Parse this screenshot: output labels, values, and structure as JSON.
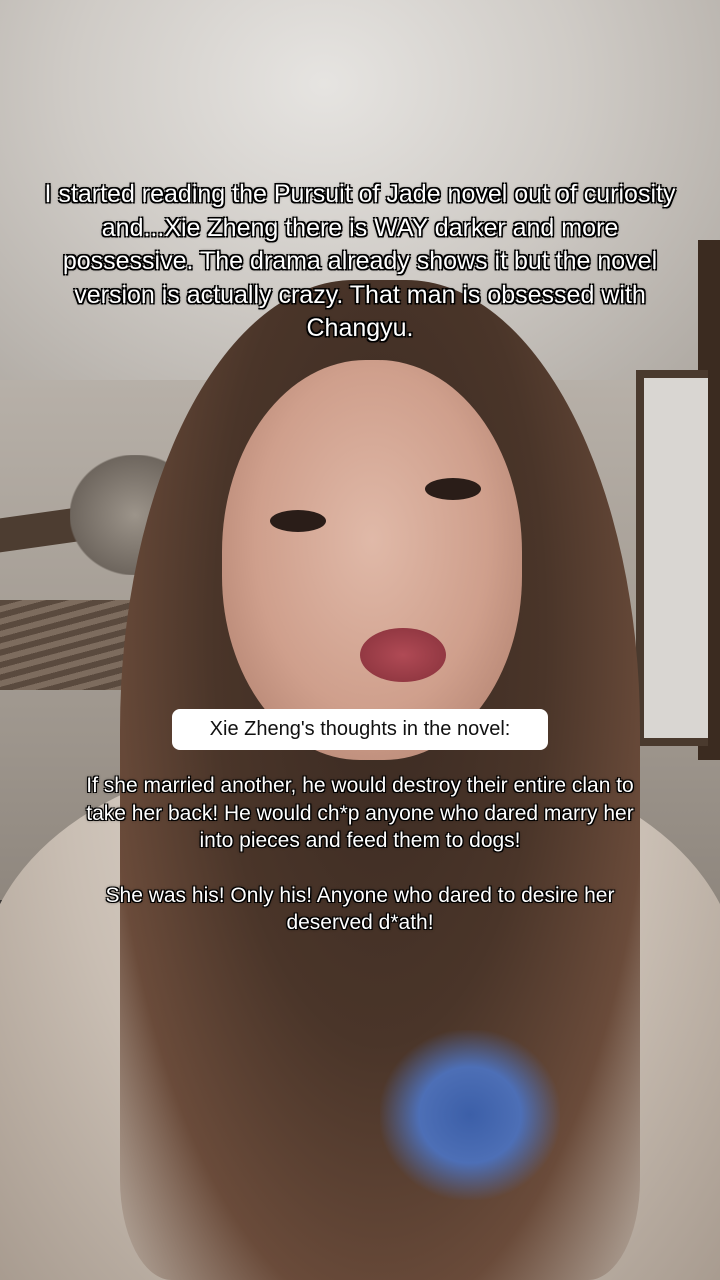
{
  "overlay": {
    "caption": "I started reading the Pursuit of Jade novel out of curiosity and...Xie Zheng there is WAY darker and more possessive. The drama already shows it but the novel version is actually crazy. That man is obsessed with Changyu.",
    "label": "Xie Zheng's thoughts in the novel:",
    "quote_paragraph_1": "If she married another, he would destroy their entire clan to take her back! He would ch*p anyone who dared marry her into pieces and feed them to dogs!",
    "quote_paragraph_2": "She was his! Only his! Anyone who dared to desire her deserved d*ath!"
  },
  "colors": {
    "caption_text": "#ffffff",
    "label_background": "#ffffff",
    "label_text": "#111111"
  }
}
